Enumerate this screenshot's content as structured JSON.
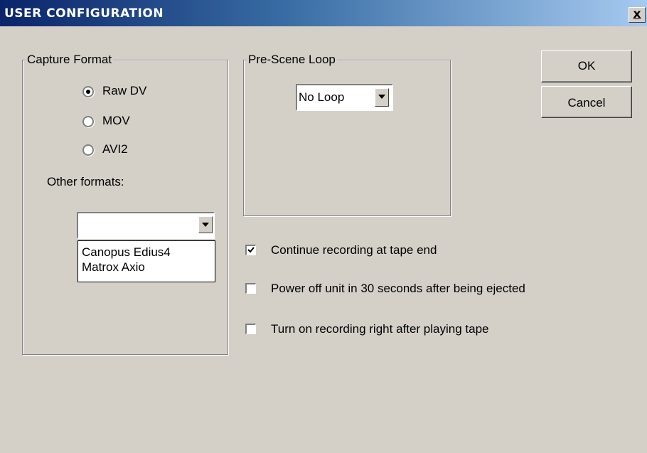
{
  "window": {
    "title": "USER CONFIGURATION",
    "close_icon": "close-icon",
    "close_label": "x"
  },
  "capture_format": {
    "label": "Capture Format",
    "options": [
      {
        "label": "Raw DV",
        "selected": true
      },
      {
        "label": "MOV",
        "selected": false
      },
      {
        "label": "AVI2",
        "selected": false
      }
    ],
    "other_formats_label": "Other formats:",
    "other_formats_value": "",
    "other_formats_list": [
      "Canopus Edius4",
      "Matrox Axio"
    ]
  },
  "pre_scene_loop": {
    "label": "Pre-Scene Loop",
    "value": "No Loop"
  },
  "buttons": {
    "ok": "OK",
    "cancel": "Cancel"
  },
  "options": [
    {
      "label": "Continue recording at tape end",
      "checked": true
    },
    {
      "label": "Power off unit in 30 seconds after being ejected",
      "checked": false
    },
    {
      "label": "Turn on recording right after playing tape",
      "checked": false
    }
  ]
}
